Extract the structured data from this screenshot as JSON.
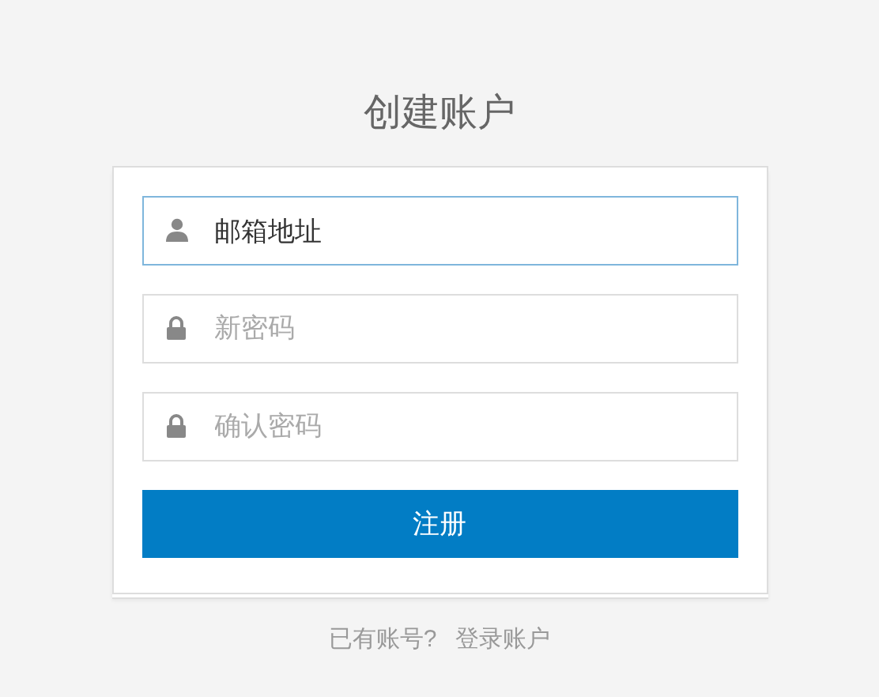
{
  "title": "创建账户",
  "fields": [
    {
      "kind": "user",
      "value": "邮箱地址",
      "focused": true
    },
    {
      "kind": "lock",
      "placeholder": "新密码",
      "focused": false
    },
    {
      "kind": "lock",
      "placeholder": "确认密码",
      "focused": false
    }
  ],
  "submit_button": "注册",
  "footer": {
    "prompt": "已有账号?",
    "link": "登录账户"
  }
}
